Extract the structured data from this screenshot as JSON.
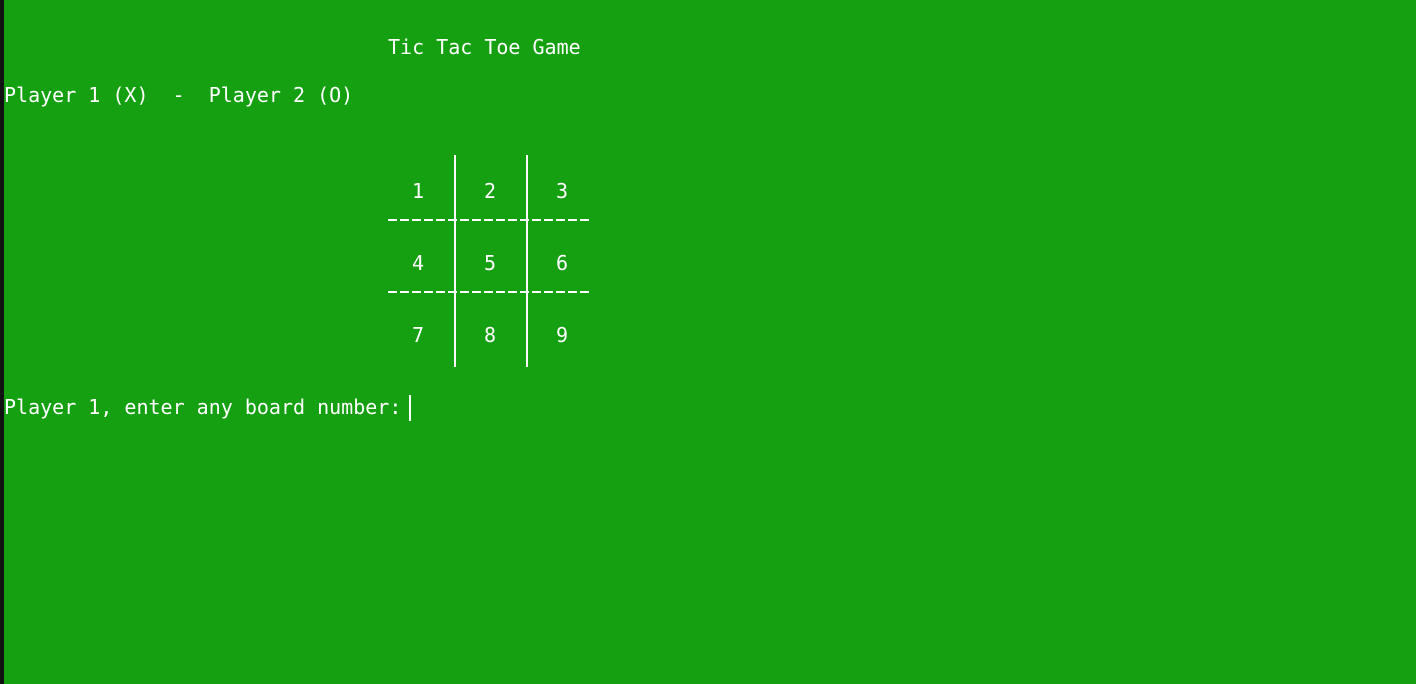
{
  "console": {
    "title_text": "Tic Tac Toe Game",
    "players_text": "Player 1 (X)  -  Player 2 (O)",
    "prompt_text": "Player 1, enter any board number:",
    "background_color": "#14a010",
    "text_color": "#ffffff"
  },
  "board": {
    "cells": [
      "1",
      "2",
      "3",
      "4",
      "5",
      "6",
      "7",
      "8",
      "9"
    ]
  }
}
